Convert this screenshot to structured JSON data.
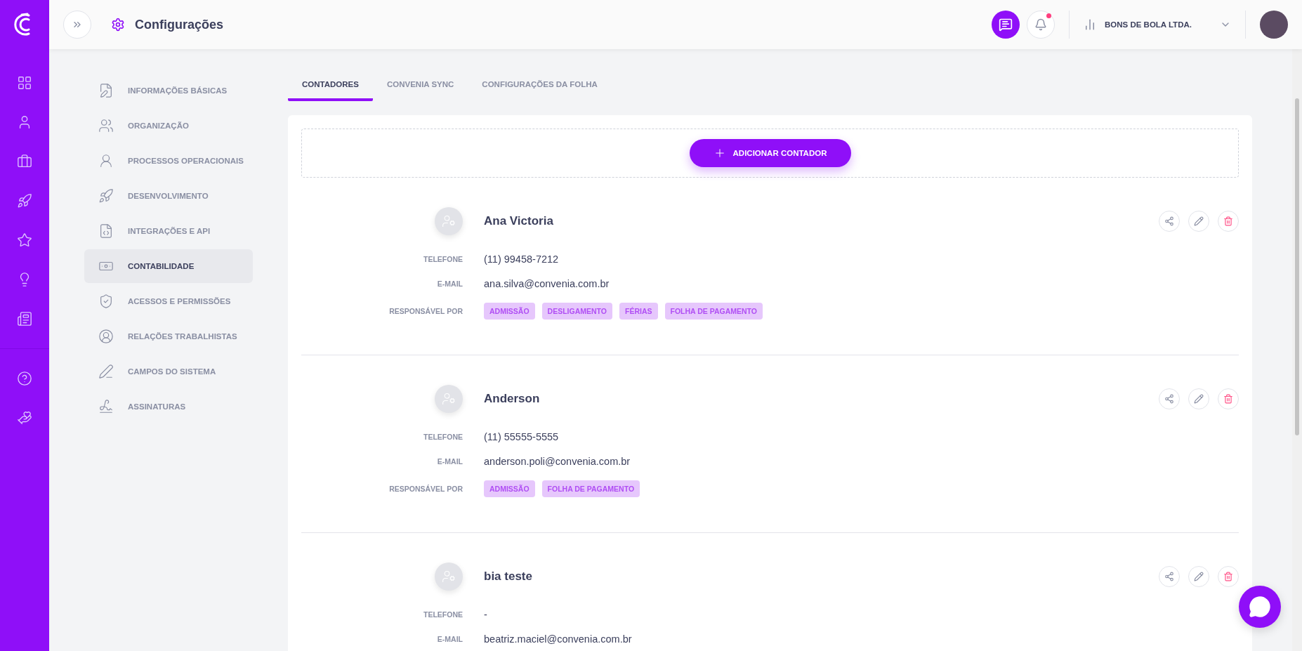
{
  "header": {
    "title": "Configurações",
    "company": "BONS DE BOLA LTDA."
  },
  "settings_nav": [
    {
      "label": "INFORMAÇÕES BÁSICAS",
      "selected": false
    },
    {
      "label": "ORGANIZAÇÃO",
      "selected": false
    },
    {
      "label": "PROCESSOS OPERACIONAIS",
      "selected": false
    },
    {
      "label": "DESENVOLVIMENTO",
      "selected": false
    },
    {
      "label": "INTEGRAÇÕES E API",
      "selected": false
    },
    {
      "label": "CONTABILIDADE",
      "selected": true
    },
    {
      "label": "ACESSOS E PERMISSÕES",
      "selected": false
    },
    {
      "label": "RELAÇÕES TRABALHISTAS",
      "selected": false
    },
    {
      "label": "CAMPOS DO SISTEMA",
      "selected": false
    },
    {
      "label": "ASSINATURAS",
      "selected": false
    }
  ],
  "tabs": [
    {
      "label": "CONTADORES",
      "selected": true
    },
    {
      "label": "CONVENIA SYNC",
      "selected": false
    },
    {
      "label": "CONFIGURAÇÕES DA FOLHA",
      "selected": false
    }
  ],
  "add_button": "ADICIONAR CONTADOR",
  "contacts": [
    {
      "name": "Ana Victoria",
      "fields": [
        {
          "label": "TELEFONE",
          "value": "(11) 99458-7212"
        },
        {
          "label": "E-MAIL",
          "value": "ana.silva@convenia.com.br"
        }
      ],
      "responsible_label": "RESPONSÁVEL POR",
      "tags": [
        "ADMISSÃO",
        "DESLIGAMENTO",
        "FÉRIAS",
        "FOLHA DE PAGAMENTO"
      ]
    },
    {
      "name": "Anderson",
      "fields": [
        {
          "label": "TELEFONE",
          "value": "(11) 55555-5555"
        },
        {
          "label": "E-MAIL",
          "value": "anderson.poli@convenia.com.br"
        }
      ],
      "responsible_label": "RESPONSÁVEL POR",
      "tags": [
        "ADMISSÃO",
        "FOLHA DE PAGAMENTO"
      ]
    },
    {
      "name": "bia teste",
      "fields": [
        {
          "label": "TELEFONE",
          "value": "-"
        },
        {
          "label": "E-MAIL",
          "value": "beatriz.maciel@convenia.com.br"
        }
      ]
    }
  ]
}
